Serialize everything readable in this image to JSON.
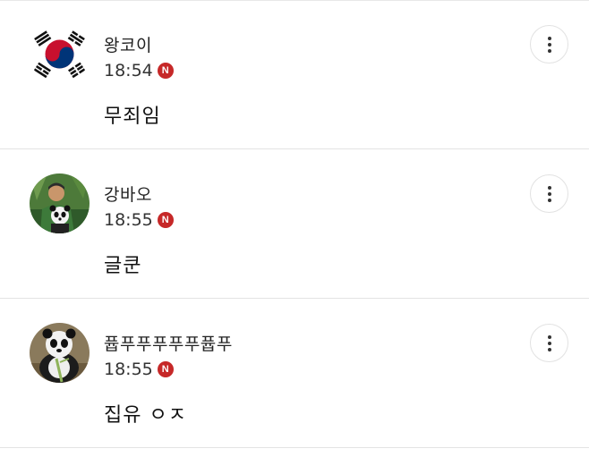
{
  "comments": [
    {
      "author": "왕코이",
      "time": "18:54",
      "badge": "N",
      "text": "무죄임",
      "avatar_icon": "korean-flag-icon"
    },
    {
      "author": "강바오",
      "time": "18:55",
      "badge": "N",
      "text": "글쿤",
      "avatar_icon": "person-with-panda-icon"
    },
    {
      "author": "퓹푸푸푸푸푸퓹푸",
      "time": "18:55",
      "badge": "N",
      "text": "집유 ㅇㅈ",
      "avatar_icon": "panda-icon"
    }
  ],
  "colors": {
    "badge": "#c62828",
    "divider": "#e3e3e3"
  }
}
